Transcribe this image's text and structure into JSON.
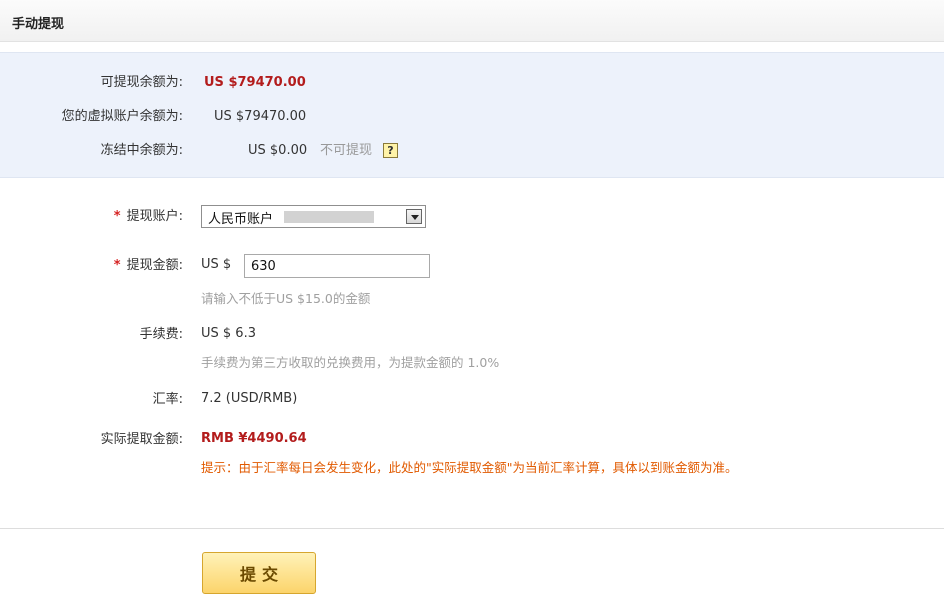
{
  "header": {
    "title": "手动提现"
  },
  "balance": {
    "withdrawable_label": "可提现余额为:",
    "withdrawable_value": "US $79470.00",
    "virtual_label": "您的虚拟账户余额为:",
    "virtual_value": "US $79470.00",
    "frozen_label": "冻结中余额为:",
    "frozen_value": "US $0.00",
    "frozen_note": "不可提现",
    "help_glyph": "?"
  },
  "form": {
    "required_mark": "*",
    "account_label": "提现账户:",
    "account_selected": "人民币账户",
    "amount_label": "提现金额:",
    "amount_prefix": "US $",
    "amount_value": "630",
    "amount_hint": "请输入不低于US $15.0的金额",
    "fee_label": "手续费:",
    "fee_value": "US $ 6.3",
    "fee_hint": "手续费为第三方收取的兑换费用，为提款金额的 1.0%",
    "rate_label": "汇率:",
    "rate_value": "7.2 (USD/RMB)",
    "actual_label": "实际提取金额:",
    "actual_value": "RMB ¥4490.64",
    "actual_warning": "提示：由于汇率每日会发生变化，此处的\"实际提取金额\"为当前汇率计算，具体以到账金额为准。"
  },
  "submit": {
    "label": "提交"
  },
  "icons": {
    "help": "help-icon",
    "dropdown": "chevron-down-icon"
  },
  "colors": {
    "accent_red": "#b31c1c",
    "warning_orange": "#e15a00",
    "panel_bg": "#edf2fb",
    "button_gold": "#fcd46b"
  }
}
